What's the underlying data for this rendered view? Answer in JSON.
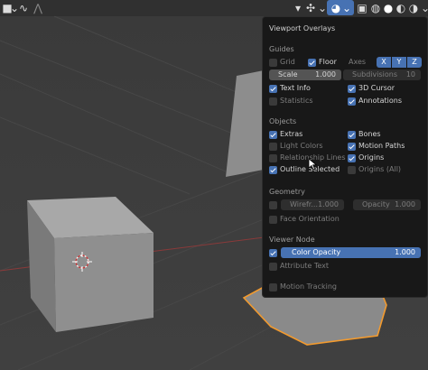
{
  "panel": {
    "title": "Viewport Overlays",
    "guides": {
      "heading": "Guides",
      "grid": "Grid",
      "floor": "Floor",
      "axes_label": "Axes",
      "axes": [
        "X",
        "Y",
        "Z"
      ],
      "scale_label": "Scale",
      "scale_value": "1.000",
      "subdivisions_label": "Subdivisions",
      "subdivisions_value": "10",
      "text_info": "Text Info",
      "cursor_3d": "3D Cursor",
      "statistics": "Statistics",
      "annotations": "Annotations"
    },
    "objects": {
      "heading": "Objects",
      "extras": "Extras",
      "bones": "Bones",
      "light_colors": "Light Colors",
      "motion_paths": "Motion Paths",
      "relationship_lines": "Relationship Lines",
      "origins": "Origins",
      "outline_selected": "Outline Selected",
      "origins_all": "Origins (All)"
    },
    "geometry": {
      "heading": "Geometry",
      "wireframe_label": "Wirefr...",
      "wireframe_value": "1.000",
      "opacity_label": "Opacity",
      "opacity_value": "1.000",
      "face_orientation": "Face Orientation"
    },
    "viewer_node": {
      "heading": "Viewer Node",
      "color_opacity_label": "Color Opacity",
      "color_opacity_value": "1.000",
      "attribute_text": "Attribute Text"
    },
    "motion_tracking": "Motion Tracking"
  },
  "colors": {
    "accent": "#4772b3",
    "selection_outline": "#f29a2e",
    "panel_bg": "#181818"
  }
}
